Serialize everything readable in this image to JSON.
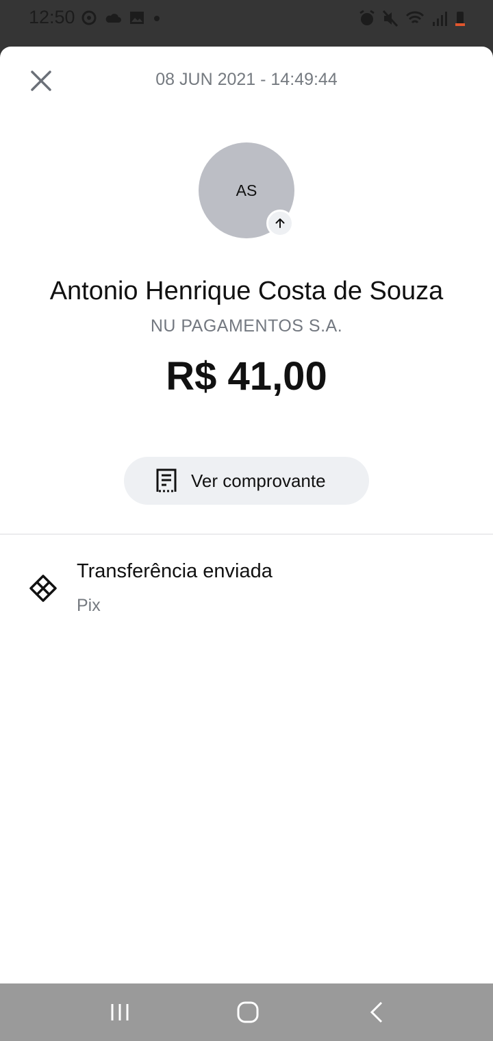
{
  "status_bar": {
    "time": "12:50",
    "left_icons": [
      "sync-icon",
      "cloud-icon",
      "image-icon",
      "dot-icon"
    ],
    "right_icons": [
      "alarm-icon",
      "mute-icon",
      "wifi-icon",
      "signal-icon",
      "battery-icon"
    ],
    "battery_color": "#e0562d"
  },
  "sheet": {
    "close_icon": "close-icon",
    "date": "08 JUN 2021 - 14:49:44"
  },
  "contact": {
    "initials": "AS",
    "badge_icon": "arrow-up-icon",
    "name": "Antonio Henrique Costa de Souza",
    "institution": "NU PAGAMENTOS S.A."
  },
  "amount": "R$ 41,00",
  "receipt_button": {
    "icon": "receipt-icon",
    "label": "Ver comprovante"
  },
  "transaction": {
    "icon": "pix-icon",
    "title": "Transferência enviada",
    "method": "Pix"
  },
  "nav_bar": {
    "buttons": [
      "recent-apps-icon",
      "home-icon",
      "back-icon"
    ]
  },
  "colors": {
    "muted_text": "#757a80",
    "avatar_bg": "#bcbec5",
    "button_bg": "#eef0f3"
  }
}
